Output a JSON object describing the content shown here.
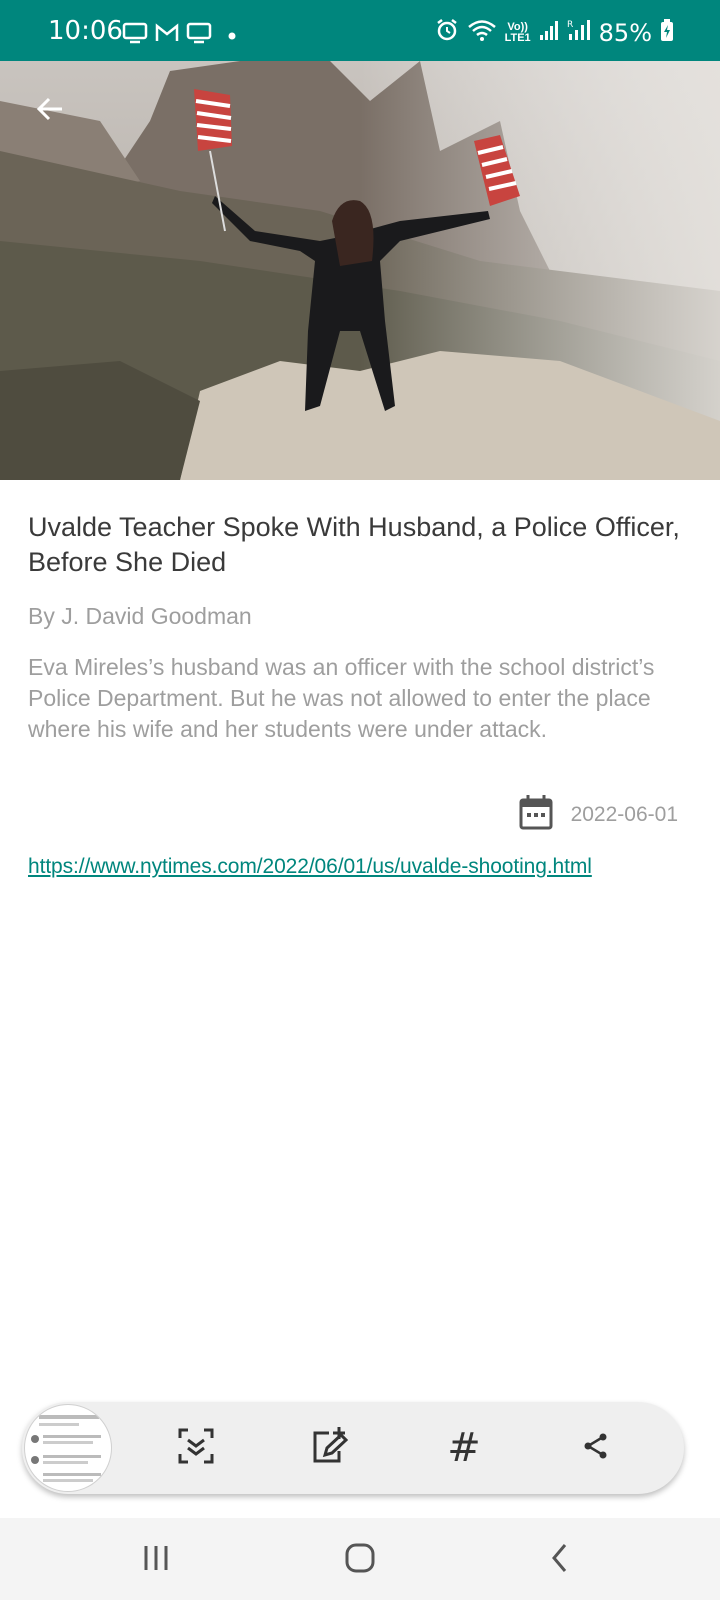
{
  "status_bar": {
    "time": "10:06",
    "battery": "85%",
    "net_label_top": "Vo))",
    "net_label_bottom": "LTE1",
    "icons": [
      "screen-cast-icon",
      "gmail-icon",
      "screen-cast-icon",
      "dot-icon",
      "alarm-icon",
      "wifi-icon",
      "signal-icon",
      "signal-roaming-icon",
      "battery-charging-icon"
    ]
  },
  "hero": {
    "back_icon": "arrow-left-icon"
  },
  "article": {
    "title": "Uvalde Teacher Spoke With Husband, a Police Officer, Before She Died",
    "byline": "By J. David Goodman",
    "summary": "Eva Mireles’s husband was an officer with the school district’s Police Department. But he was not allowed to enter the place where his wife and her students were under attack.",
    "date": "2022-06-01",
    "date_icon": "calendar-icon",
    "url": "https://www.nytimes.com/2022/06/01/us/uvalde-shooting.html"
  },
  "toolbar": {
    "items": [
      "capture-thumbnail",
      "smart-select-icon",
      "draw-icon",
      "hashtag-icon",
      "share-icon"
    ],
    "hash_symbol": "#"
  },
  "navbar": {
    "items": [
      "recent-apps-icon",
      "home-icon",
      "back-icon"
    ]
  },
  "colors": {
    "accent": "#00867d",
    "text_primary": "#3a3a3a",
    "text_secondary": "#9e9e9e"
  }
}
